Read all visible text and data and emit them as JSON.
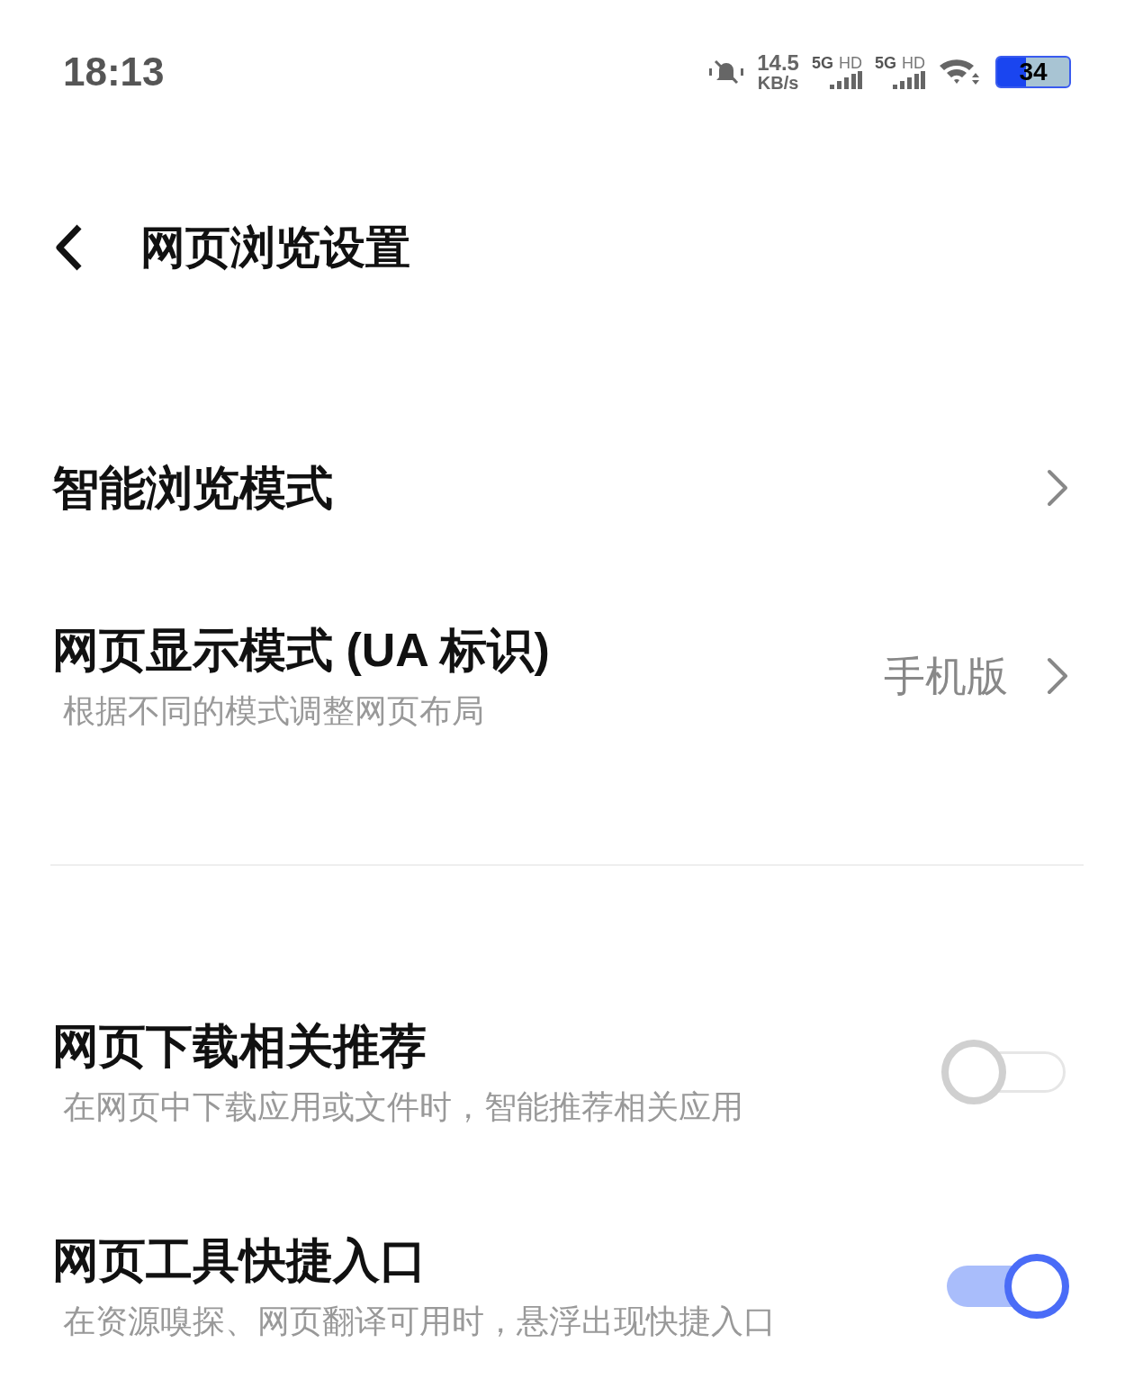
{
  "status_bar": {
    "time": "18:13",
    "speed": "14.5",
    "speed_unit": "KB/s",
    "sims": [
      {
        "network": "5G",
        "hd": "HD"
      },
      {
        "network": "5G",
        "hd": "HD"
      }
    ],
    "battery": "34"
  },
  "header": {
    "title": "网页浏览设置"
  },
  "groups": [
    {
      "items": [
        {
          "kind": "link",
          "title": "智能浏览模式"
        },
        {
          "kind": "link",
          "title": "网页显示模式 (UA 标识)",
          "subtitle": "根据不同的模式调整网页布局",
          "value": "手机版"
        }
      ]
    },
    {
      "items": [
        {
          "kind": "switch",
          "title": "网页下载相关推荐",
          "subtitle": "在网页中下载应用或文件时，智能推荐相关应用",
          "on": false
        },
        {
          "kind": "switch",
          "title": "网页工具快捷入口",
          "subtitle": "在资源嗅探、网页翻译可用时，悬浮出现快捷入口",
          "on": true
        }
      ]
    }
  ]
}
